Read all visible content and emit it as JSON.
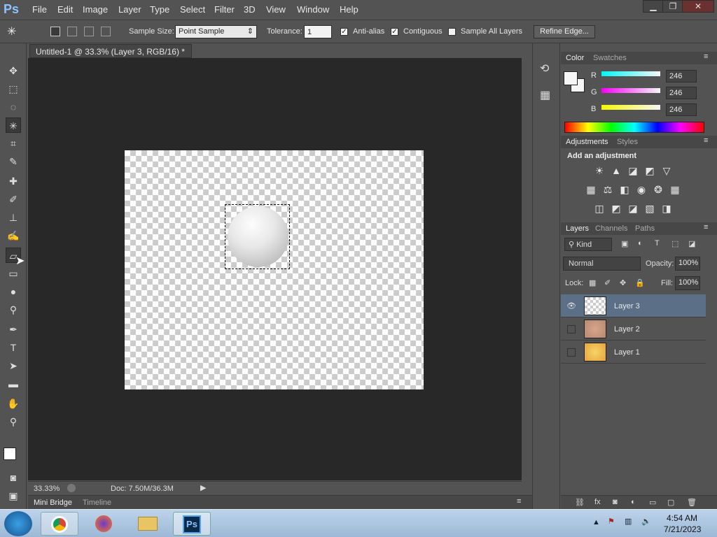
{
  "app": {
    "logo": "Ps"
  },
  "menu": [
    "File",
    "Edit",
    "Image",
    "Layer",
    "Type",
    "Select",
    "Filter",
    "3D",
    "View",
    "Window",
    "Help"
  ],
  "window_controls": {
    "minimize": "▁",
    "restore": "❐",
    "close": "✕"
  },
  "options": {
    "sample_size_label": "Sample Size:",
    "sample_size_value": "Point Sample",
    "tolerance_label": "Tolerance:",
    "tolerance_value": "1",
    "antialias_label": "Anti-alias",
    "contiguous_label": "Contiguous",
    "sample_all_layers_label": "Sample All Layers",
    "refine_edge_label": "Refine Edge..."
  },
  "document": {
    "tab_title": "Untitled-1 @ 33.3% (Layer 3, RGB/16) *",
    "tab_close": "×",
    "zoom": "33.33%",
    "doc_info": "Doc: 7.50M/36.3M"
  },
  "bottom_tabs": {
    "mini_bridge": "Mini Bridge",
    "timeline": "Timeline"
  },
  "color_panel": {
    "tab_color": "Color",
    "tab_swatches": "Swatches",
    "r_label": "R",
    "g_label": "G",
    "b_label": "B",
    "r": "246",
    "g": "246",
    "b": "246"
  },
  "adjustments_panel": {
    "tab_adjustments": "Adjustments",
    "tab_styles": "Styles",
    "heading": "Add an adjustment"
  },
  "layers_panel": {
    "tab_layers": "Layers",
    "tab_channels": "Channels",
    "tab_paths": "Paths",
    "kind_label": "Kind",
    "blend_mode": "Normal",
    "opacity_label": "Opacity:",
    "opacity_value": "100%",
    "lock_label": "Lock:",
    "fill_label": "Fill:",
    "fill_value": "100%",
    "layers": [
      {
        "name": "Layer 3",
        "visible": true,
        "selected": true
      },
      {
        "name": "Layer 2",
        "visible": false,
        "selected": false
      },
      {
        "name": "Layer 1",
        "visible": false,
        "selected": false
      }
    ]
  },
  "taskbar": {
    "time": "4:54 AM",
    "date": "7/21/2023",
    "ps_label": "Ps"
  },
  "colors": {
    "accent_ps": "#8cc3ff",
    "selected_layer": "#5b6f86",
    "canvas_bg": "#282828"
  }
}
